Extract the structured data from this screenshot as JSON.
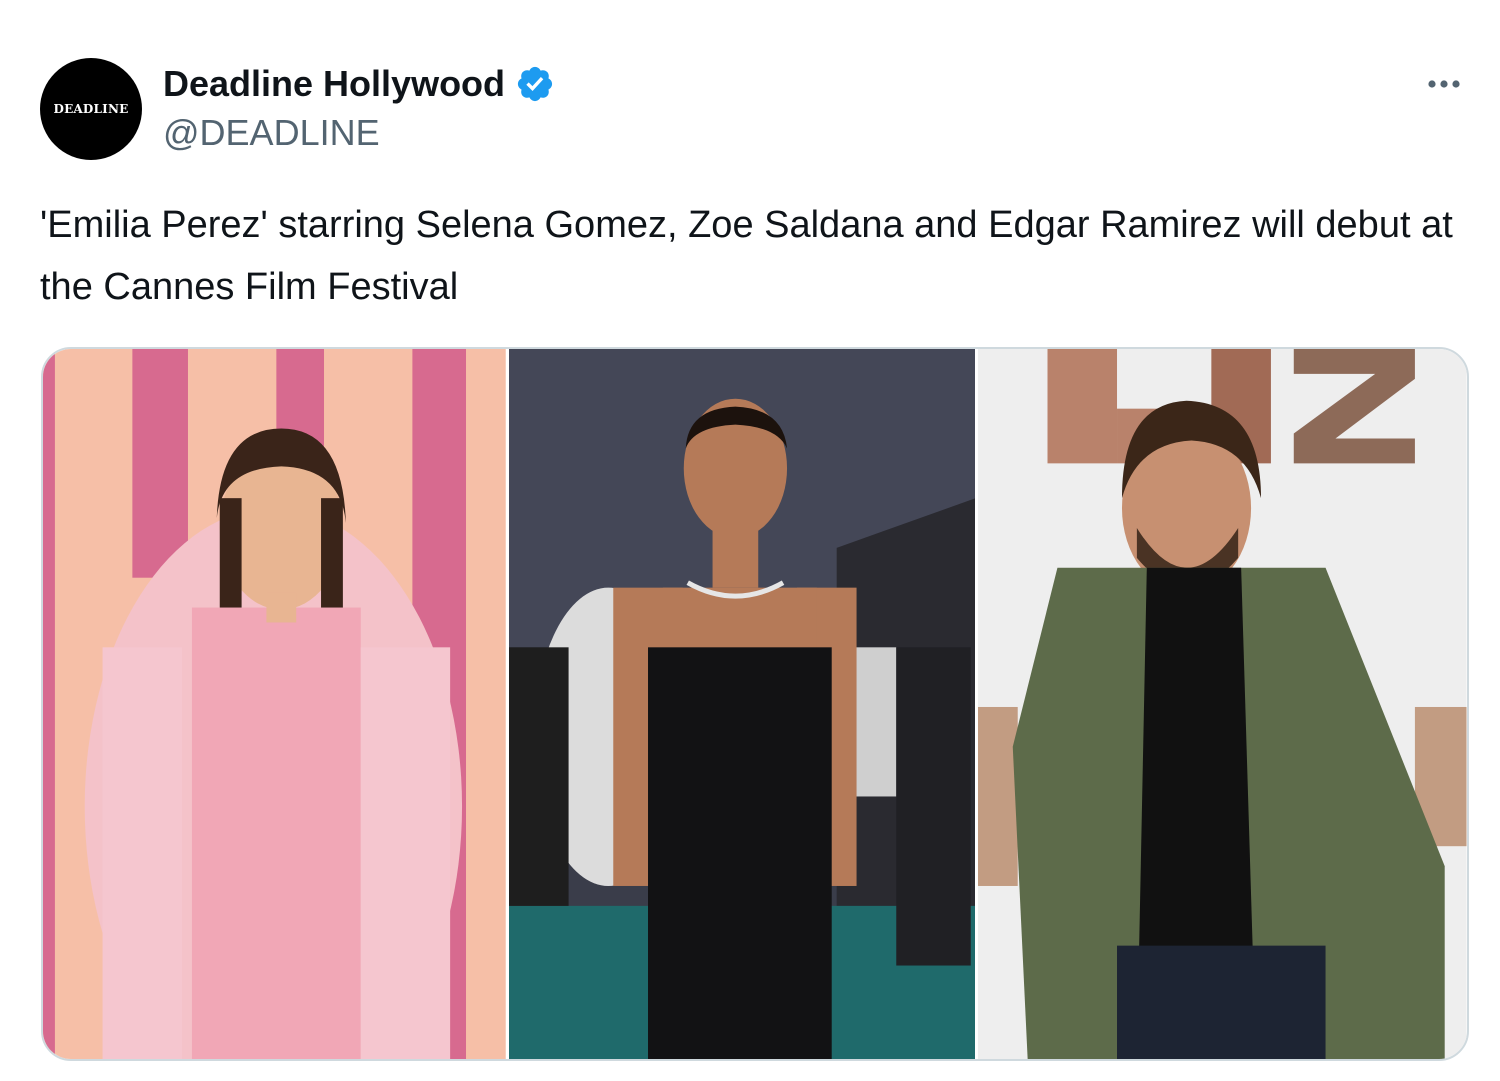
{
  "tweet": {
    "author": {
      "avatar_text": "DEADLINE",
      "display_name": "Deadline Hollywood",
      "handle": "@DEADLINE",
      "verified_icon": "verified-badge-icon",
      "verified_color": "#1d9bf0"
    },
    "more_icon": "more-options-icon",
    "text": "'Emilia Perez' starring Selena Gomez, Zoe Saldana and Edgar Ramirez will debut at the Cannes Film Festival",
    "media": {
      "photos": [
        {
          "description_name": "photo-selena-gomez"
        },
        {
          "description_name": "photo-zoe-saldana"
        },
        {
          "description_name": "photo-edgar-ramirez",
          "backdrop_text": "LUZ"
        }
      ]
    }
  },
  "colors": {
    "text_primary": "#0f1419",
    "text_secondary": "#536471",
    "border": "#cfd9de"
  }
}
